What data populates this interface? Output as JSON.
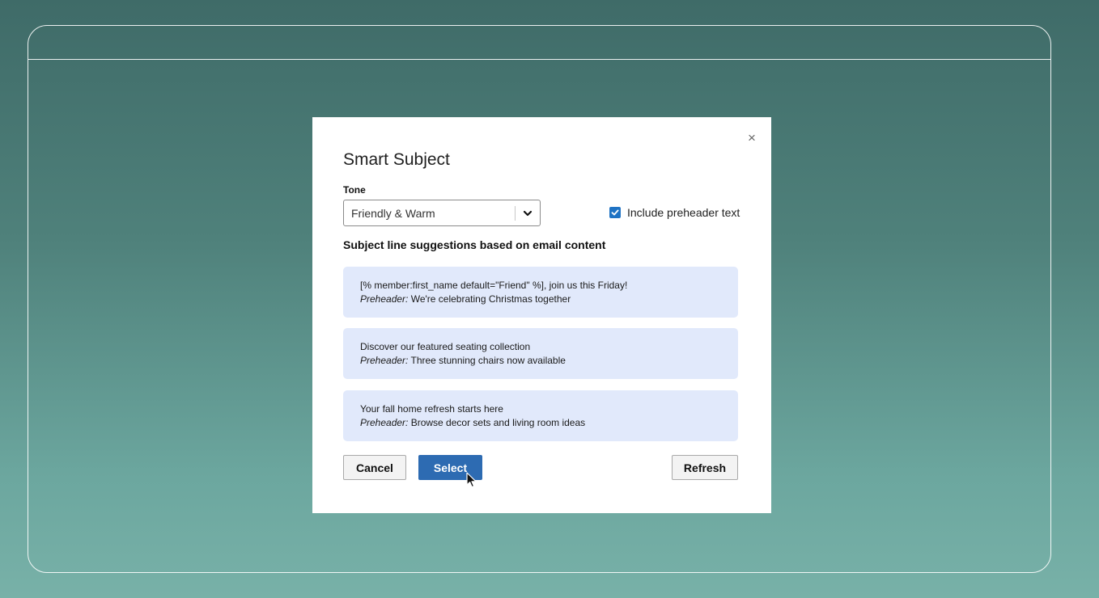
{
  "dialog": {
    "title": "Smart Subject",
    "close_glyph": "×",
    "tone": {
      "label": "Tone",
      "selected": "Friendly & Warm"
    },
    "include_preheader": {
      "label": "Include preheader text",
      "checked": true
    },
    "suggestions_heading": "Subject line suggestions based on email content",
    "suggestions": [
      {
        "subject": "[% member:first_name default=\"Friend\" %], join us this Friday!",
        "preheader_label": "Preheader:",
        "preheader": " We're celebrating Christmas together"
      },
      {
        "subject": "Discover our featured seating collection",
        "preheader_label": "Preheader:",
        "preheader": " Three stunning chairs now available"
      },
      {
        "subject": "Your fall home refresh starts here",
        "preheader_label": "Preheader:",
        "preheader": " Browse decor sets and living room ideas"
      }
    ],
    "buttons": {
      "cancel": "Cancel",
      "select": "Select",
      "refresh": "Refresh"
    }
  },
  "colors": {
    "accent": "#2d6bb2",
    "suggestion_bg": "#e1e9fb",
    "checkbox": "#1f73c4"
  },
  "icons": {
    "close": "close-icon",
    "dropdown": "chevron-down-icon",
    "checkbox": "checkmark-icon",
    "pointer": "mouse-cursor-icon"
  }
}
